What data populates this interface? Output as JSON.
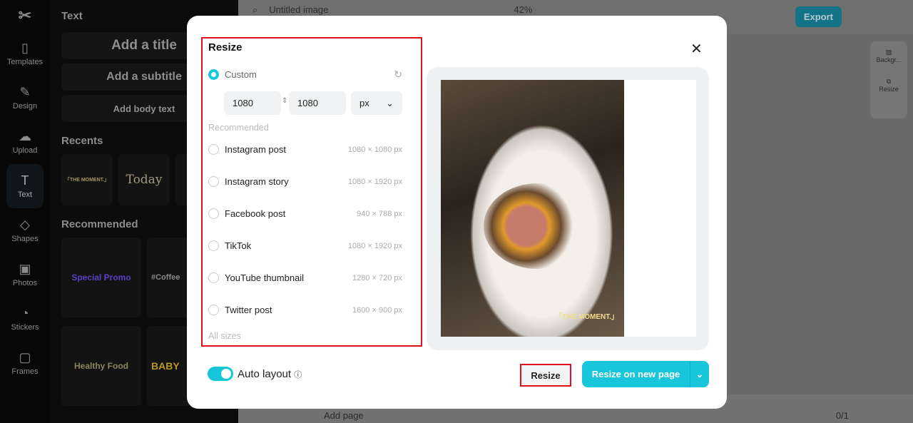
{
  "rail": {
    "items": [
      {
        "label": "Templates",
        "icon": "templates-icon"
      },
      {
        "label": "Design",
        "icon": "design-icon"
      },
      {
        "label": "Upload",
        "icon": "upload-icon"
      },
      {
        "label": "Text",
        "icon": "text-icon"
      },
      {
        "label": "Shapes",
        "icon": "shapes-icon"
      },
      {
        "label": "Photos",
        "icon": "photos-icon"
      },
      {
        "label": "Stickers",
        "icon": "stickers-icon"
      },
      {
        "label": "Frames",
        "icon": "frames-icon"
      }
    ]
  },
  "panel": {
    "title": "Text",
    "add_title": "Add a title",
    "add_subtitle": "Add a subtitle",
    "add_body": "Add body text",
    "recents": "Recents",
    "recent_items": [
      "「THE MOMENT.」",
      "Today"
    ],
    "recommended": "Recommended",
    "rec_items": [
      "Special Promo",
      "#Coffee",
      "Healthy Food",
      "BABY"
    ]
  },
  "topbar": {
    "doc_title": "Untitled image",
    "zoom": "42%",
    "export": "Export"
  },
  "side": {
    "background": "Backgr...",
    "resize": "Resize"
  },
  "bottom": {
    "add_page": "Add page",
    "page": "0/1"
  },
  "modal": {
    "title": "Resize",
    "custom": "Custom",
    "width": "1080",
    "height": "1080",
    "unit": "px",
    "recommended": "Recommended",
    "all_sizes": "All sizes",
    "options": [
      {
        "label": "Instagram post",
        "size": "1080 × 1080 px"
      },
      {
        "label": "Instagram story",
        "size": "1080 × 1920 px"
      },
      {
        "label": "Facebook post",
        "size": "940 × 788 px"
      },
      {
        "label": "TikTok",
        "size": "1080 × 1920 px"
      },
      {
        "label": "YouTube thumbnail",
        "size": "1280 × 720 px"
      },
      {
        "label": "Twitter post",
        "size": "1600 × 900 px"
      }
    ],
    "preview_text": "「THE MOMENT.」",
    "auto_layout": "Auto layout",
    "auto_layout_on": true,
    "resize": "Resize",
    "resize_new": "Resize on new page"
  },
  "colors": {
    "accent": "#18c6dc",
    "highlight": "#e0101a"
  }
}
